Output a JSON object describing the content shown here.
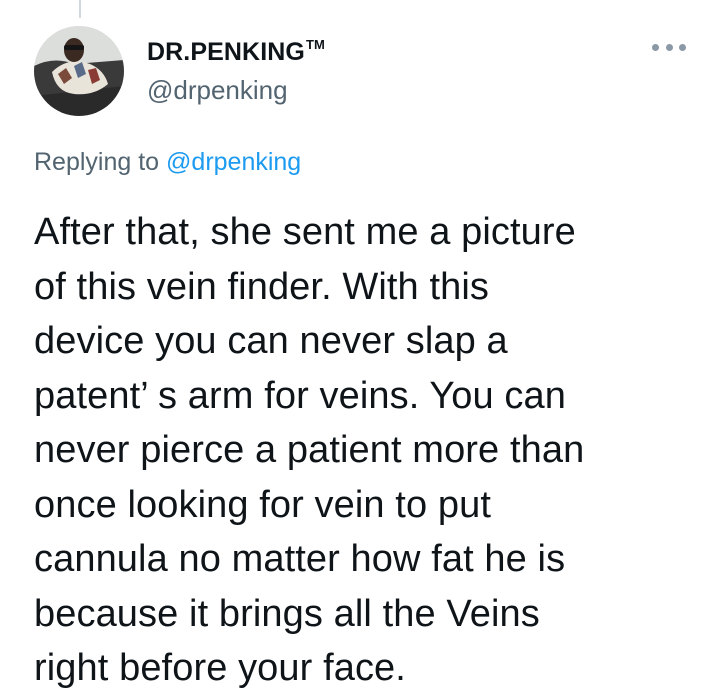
{
  "author": {
    "display_name": "DR.PENKING",
    "trademark": "TM",
    "handle": "@drpenking"
  },
  "reply": {
    "prefix": "Replying to ",
    "mention": "@drpenking"
  },
  "tweet": {
    "lines": [
      "After that, she sent me a picture",
      "of this vein finder. With this",
      "device you can never slap a",
      "patent’ s arm for veins. You can",
      "never pierce a patient more than",
      "once looking for vein to put",
      "cannula no matter how fat he is",
      "because it brings all the Veins",
      "right before your face."
    ]
  },
  "icons": {
    "avatar": "profile-photo",
    "more": "more-options-icon"
  },
  "colors": {
    "text": "#0f1419",
    "secondary": "#536471",
    "link": "#1d9bf0",
    "thread_line": "#cfd9de"
  }
}
